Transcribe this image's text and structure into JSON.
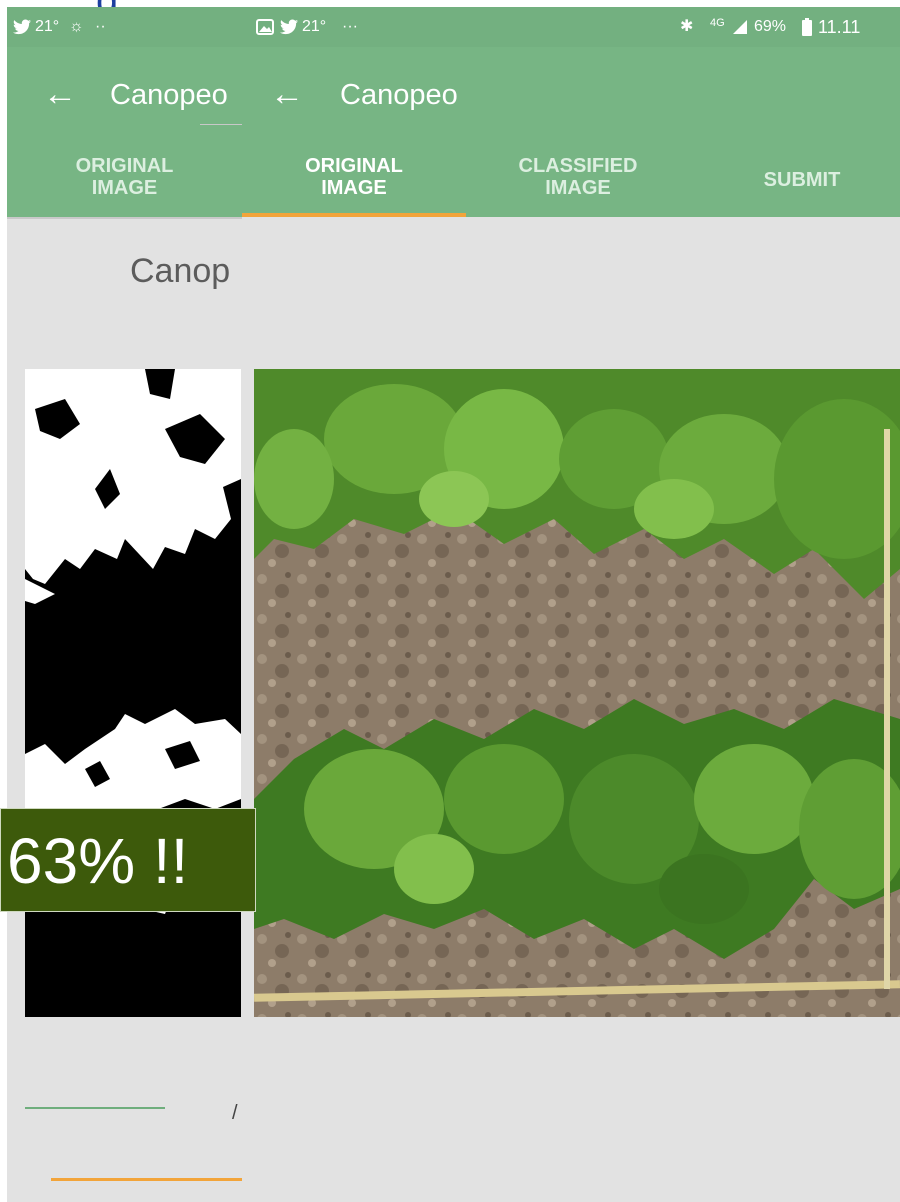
{
  "left_screen": {
    "status": {
      "left": "21°",
      "dots": "··"
    },
    "app_title": "Canopeo",
    "tabs": [
      {
        "label": "ORIGINAL IMAGE"
      }
    ],
    "content_text": "Canop",
    "tiny_mark": "/"
  },
  "right_screen": {
    "status": {
      "left": "21°",
      "dots": "···",
      "network": "4G",
      "battery": "69%",
      "time": "11.11"
    },
    "app_title": "Canopeo",
    "tabs": [
      {
        "label_line1": "ORIGINAL",
        "label_line2": "IMAGE",
        "active": true
      },
      {
        "label_line1": "CLASSIFIED",
        "label_line2": "IMAGE",
        "active": false
      },
      {
        "label_line1": "SUBMIT",
        "label_line2": "",
        "active": false
      }
    ]
  },
  "overlay_badge": "63% !!",
  "colors": {
    "appbar_green": "#77b584",
    "status_green": "#73b080",
    "tab_indicator": "#f2a43a",
    "badge_bg": "#3d5a0b",
    "content_bg": "#e2e2e2"
  }
}
